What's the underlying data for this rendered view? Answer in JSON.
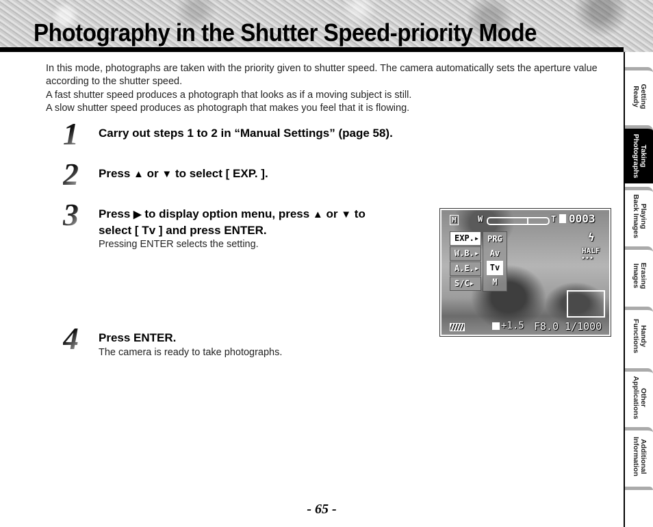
{
  "header": {
    "title": "Photography in the Shutter Speed-priority Mode"
  },
  "intro": [
    "In this mode, photographs are taken with the priority given to shutter speed. The camera automatically sets the aperture value according to the shutter speed.",
    "A fast shutter speed produces a photograph that looks as if a moving subject is still.",
    "A slow shutter speed produces as photograph that makes you feel that it is flowing."
  ],
  "steps": [
    {
      "number": "1",
      "text": "Carry out steps 1 to 2 in “Manual Settings” (page 58)."
    },
    {
      "number": "2",
      "text_pre": "Press ",
      "up": "▲",
      "or": " or ",
      "down": "▼",
      "text_post": " to select [ EXP. ]."
    },
    {
      "number": "3",
      "line1_pre": "Press ",
      "right": "▶",
      "line1_mid": " to display option menu, press ",
      "up": "▲",
      "or": " or ",
      "down": "▼",
      "line1_post": " to",
      "line2": "select  [ Tv ] and press ENTER.",
      "sub": "Pressing ENTER selects the setting."
    },
    {
      "number": "4",
      "text": "Press ENTER.",
      "sub": "The camera is ready to take photographs."
    }
  ],
  "camera_screen": {
    "mode_icon": "M",
    "zoom_wide": "W",
    "zoom_tele": "T",
    "frame_count": "0003",
    "flash_icon": "ϟ",
    "quality": "HALF",
    "quality_stars": "★★★",
    "menu": [
      "EXP.▸",
      "W.B.▸",
      "A.E.▸",
      "S/C▸"
    ],
    "options": [
      "PRG",
      "Av",
      "Tv",
      "M"
    ],
    "selected_menu": "EXP.",
    "selected_option": "Tv",
    "battery_icon": "battery-icon",
    "exposure_comp": "+1.5",
    "aperture": "F8.0",
    "shutter_speed": "1/1000"
  },
  "tabs": [
    {
      "label_line1": "Getting",
      "label_line2": "Ready",
      "active": false
    },
    {
      "label_line1": "Taking",
      "label_line2": "Photographs",
      "active": true
    },
    {
      "label_line1": "Playing",
      "label_line2": "Back Images",
      "active": false
    },
    {
      "label_line1": "Erasing",
      "label_line2": "Images",
      "active": false
    },
    {
      "label_line1": "Handy",
      "label_line2": "Functions",
      "active": false
    },
    {
      "label_line1": "Other",
      "label_line2": "Applications",
      "active": false
    },
    {
      "label_line1": "Additional",
      "label_line2": "Information",
      "active": false
    }
  ],
  "page_number": "- 65 -"
}
